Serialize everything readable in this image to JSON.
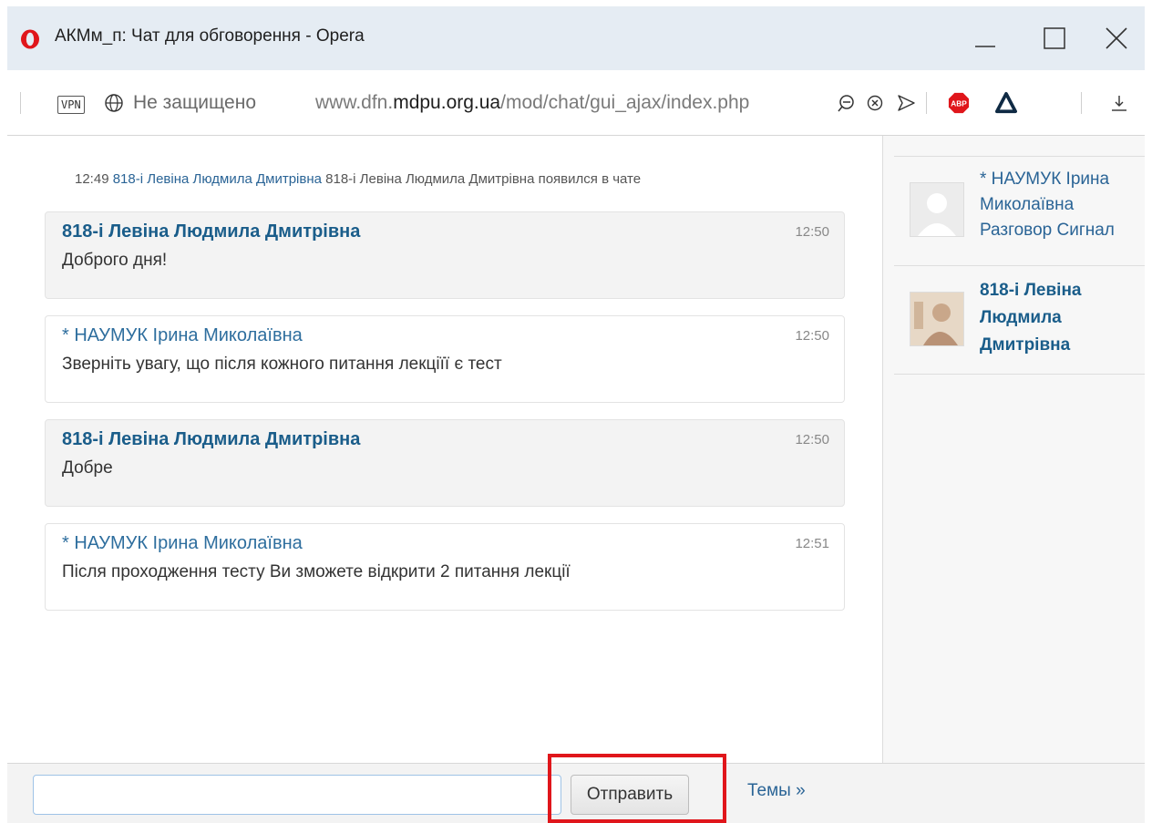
{
  "window": {
    "title": "АКМм_п: Чат для обговорення - Opera",
    "accent_color": "#e0161b"
  },
  "addressbar": {
    "vpn_label": "VPN",
    "security_text": "Не защищено",
    "url_prefix": "www.dfn.",
    "url_host": "mdpu.org.ua",
    "url_path": "/mod/chat/gui_ajax/index.php"
  },
  "chat": {
    "system_message": {
      "time": "12:49",
      "user": "818-і Левіна Людмила Дмитрівна",
      "text": "818-і Левіна Людмила Дмитрівна появился в чате"
    },
    "messages": [
      {
        "author": "818-і Левіна Людмила Дмитрівна",
        "time": "12:50",
        "text": "Доброго дня!"
      },
      {
        "author": "* НАУМУК Ірина Миколаївна",
        "time": "12:50",
        "text": "Зверніть увагу, що після кожного питання лекціїї є тест"
      },
      {
        "author": "818-і Левіна Людмила Дмитрівна",
        "time": "12:50",
        "text": "Добре"
      },
      {
        "author": "* НАУМУК Ірина Миколаївна",
        "time": "12:51",
        "text": "Після проходження тесту Ви зможете відкрити 2 питання лекції"
      }
    ]
  },
  "users": [
    {
      "line1": "* НАУМУК Ірина",
      "line2": "Миколаївна",
      "line3": "Разговор Сигнал"
    },
    {
      "line1": "818-і Левіна",
      "line2": "Людмила",
      "line3": "Дмитрівна"
    }
  ],
  "input": {
    "value": "",
    "send_label": "Отправить",
    "topics_label": "Темы »"
  }
}
